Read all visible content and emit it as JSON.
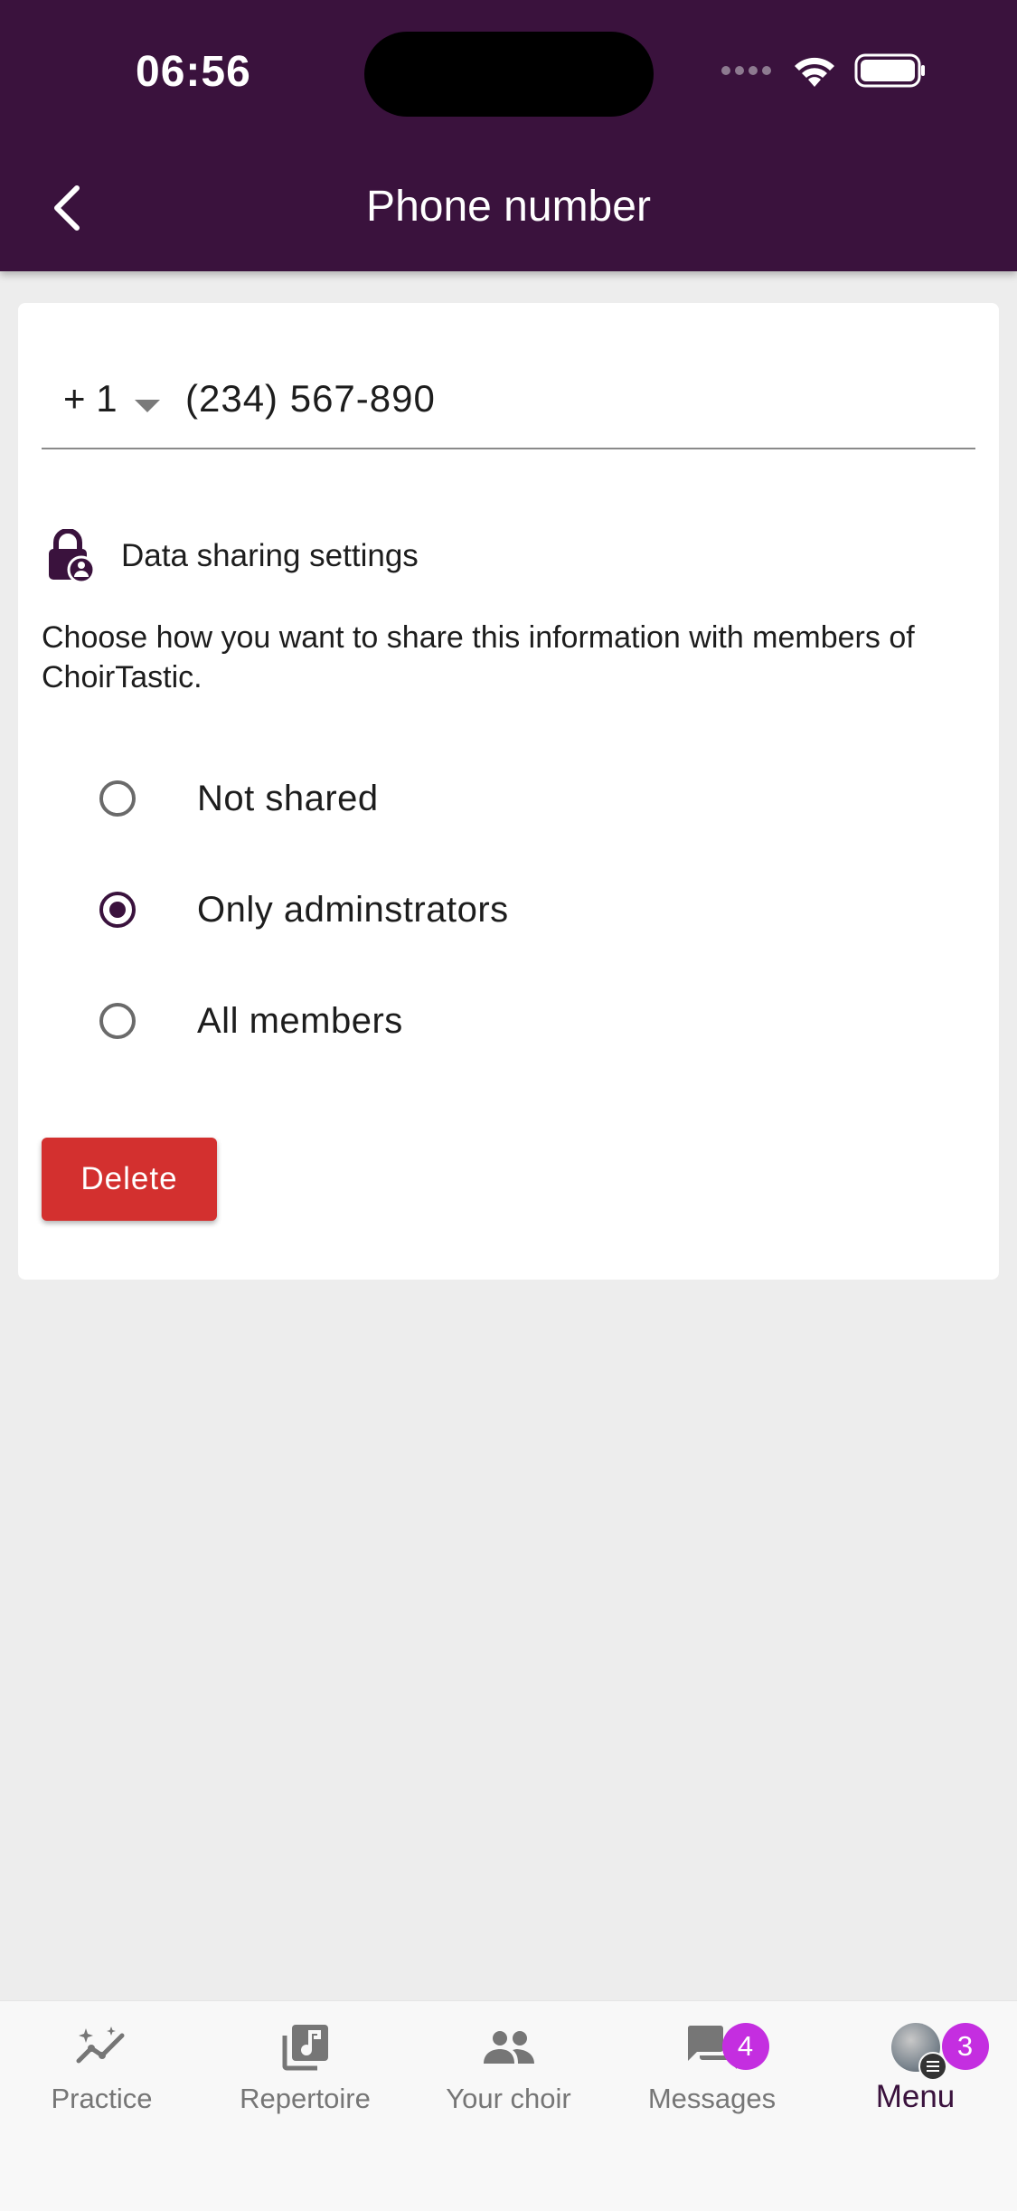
{
  "status_bar": {
    "time": "06:56"
  },
  "header": {
    "title": "Phone number",
    "background_color": "#3a123d"
  },
  "phone": {
    "country_code": "+ 1",
    "value": "(234) 567-890"
  },
  "sharing": {
    "label": "Data sharing settings",
    "description": "Choose how you want to share this information with members of ChoirTastic.",
    "selected": "Only adminstrators",
    "options": [
      {
        "label": "Not shared"
      },
      {
        "label": "Only adminstrators"
      },
      {
        "label": "All members"
      }
    ]
  },
  "delete_button": {
    "label": "Delete",
    "color": "#d3302f"
  },
  "bottom_nav": {
    "items": [
      {
        "label": "Practice",
        "icon": "practice-sparkle-chart-icon"
      },
      {
        "label": "Repertoire",
        "icon": "music-library-icon"
      },
      {
        "label": "Your choir",
        "icon": "people-icon"
      },
      {
        "label": "Messages",
        "icon": "chat-bubbles-icon",
        "badge": "4"
      },
      {
        "label": "Menu",
        "icon": "avatar-menu-icon",
        "badge": "3",
        "active": true
      }
    ],
    "badge_color": "#c42ee0"
  }
}
